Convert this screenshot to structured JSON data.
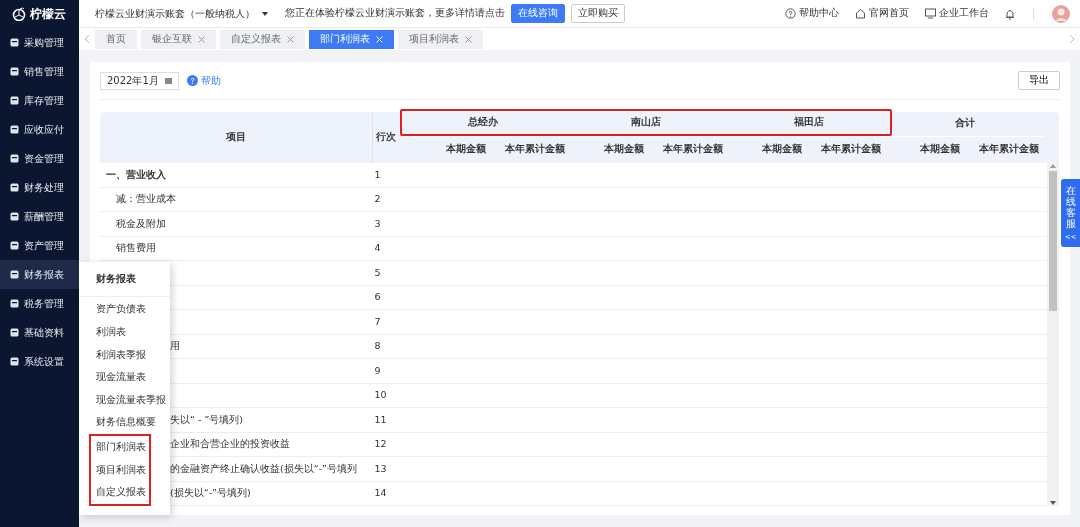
{
  "logo": {
    "text": "柠檬云"
  },
  "header": {
    "account": "柠檬云业财演示账套（一般纳税人）",
    "notice": "您正在体验柠檬云业财演示账套，更多详情请点击",
    "consult_button": "在线咨询",
    "buy_button": "立即购买",
    "links": [
      {
        "label": "帮助中心",
        "kind": "help"
      },
      {
        "label": "官网首页",
        "kind": "home"
      },
      {
        "label": "企业工作台",
        "kind": "monitor"
      }
    ]
  },
  "sidebar": {
    "items": [
      {
        "label": "采购管理",
        "selected": false
      },
      {
        "label": "销售管理",
        "selected": false
      },
      {
        "label": "库存管理",
        "selected": false
      },
      {
        "label": "应收应付",
        "selected": false
      },
      {
        "label": "资金管理",
        "selected": false
      },
      {
        "label": "财务处理",
        "selected": false
      },
      {
        "label": "薪酬管理",
        "selected": false
      },
      {
        "label": "资产管理",
        "selected": false
      },
      {
        "label": "财务报表",
        "selected": true
      },
      {
        "label": "税务管理",
        "selected": false
      },
      {
        "label": "基础资料",
        "selected": false
      },
      {
        "label": "系统设置",
        "selected": false
      }
    ]
  },
  "tabs": [
    {
      "label": "首页",
      "closable": false,
      "selected": false
    },
    {
      "label": "银企互联",
      "closable": true,
      "selected": false
    },
    {
      "label": "自定义报表",
      "closable": true,
      "selected": false
    },
    {
      "label": "部门利润表",
      "closable": true,
      "selected": true
    },
    {
      "label": "项目利润表",
      "closable": true,
      "selected": false
    }
  ],
  "toolbar": {
    "period": "2022年1月",
    "help": "帮助",
    "export": "导出"
  },
  "table": {
    "item_header": "项目",
    "line_header": "行次",
    "groups": [
      {
        "name": "总经办",
        "highlighted": true,
        "columns": [
          "本期金额",
          "本年累计金额"
        ]
      },
      {
        "name": "南山店",
        "highlighted": true,
        "columns": [
          "本期金额",
          "本年累计金额"
        ]
      },
      {
        "name": "福田店",
        "highlighted": true,
        "columns": [
          "本期金额",
          "本年累计金额"
        ]
      },
      {
        "name": "合计",
        "highlighted": false,
        "columns": [
          "本期金额",
          "本年累计金额"
        ]
      }
    ],
    "rows": [
      {
        "item": "一、营业收入",
        "line": "1",
        "kind": "heading"
      },
      {
        "item": "减：营业成本",
        "line": "2",
        "kind": "item"
      },
      {
        "item": "税金及附加",
        "line": "3",
        "kind": "item"
      },
      {
        "item": "销售费用",
        "line": "4",
        "kind": "item"
      },
      {
        "line": "5",
        "kind": "partial"
      },
      {
        "line": "6",
        "kind": "partial"
      },
      {
        "line": "7",
        "kind": "partial"
      },
      {
        "item": "用",
        "line": "8",
        "kind": "partial"
      },
      {
        "line": "9",
        "kind": "partial"
      },
      {
        "line": "10",
        "kind": "partial"
      },
      {
        "item": "失以“ - ”号填列)",
        "line": "11",
        "kind": "partial"
      },
      {
        "item": "企业和合营企业的投资收益",
        "line": "12",
        "kind": "partial"
      },
      {
        "item": "的金融资产终止确认收益(损失以“-”号填列",
        "line": "13",
        "kind": "partial"
      },
      {
        "item": "(损失以“-”号填列)",
        "line": "14",
        "kind": "partial"
      }
    ]
  },
  "popup_menu": {
    "title": "财务报表",
    "items": [
      {
        "label": "资产负债表",
        "highlighted": false
      },
      {
        "label": "利润表",
        "highlighted": false
      },
      {
        "label": "利润表季报",
        "highlighted": false
      },
      {
        "label": "现金流量表",
        "highlighted": false
      },
      {
        "label": "现金流量表季报",
        "highlighted": false
      },
      {
        "label": "财务信息概要",
        "highlighted": false
      },
      {
        "label": "部门利润表",
        "highlighted": true
      },
      {
        "label": "项目利润表",
        "highlighted": true
      },
      {
        "label": "自定义报表",
        "highlighted": true
      }
    ]
  },
  "service_tab": {
    "label": "在线客服",
    "arrow": "<<"
  }
}
